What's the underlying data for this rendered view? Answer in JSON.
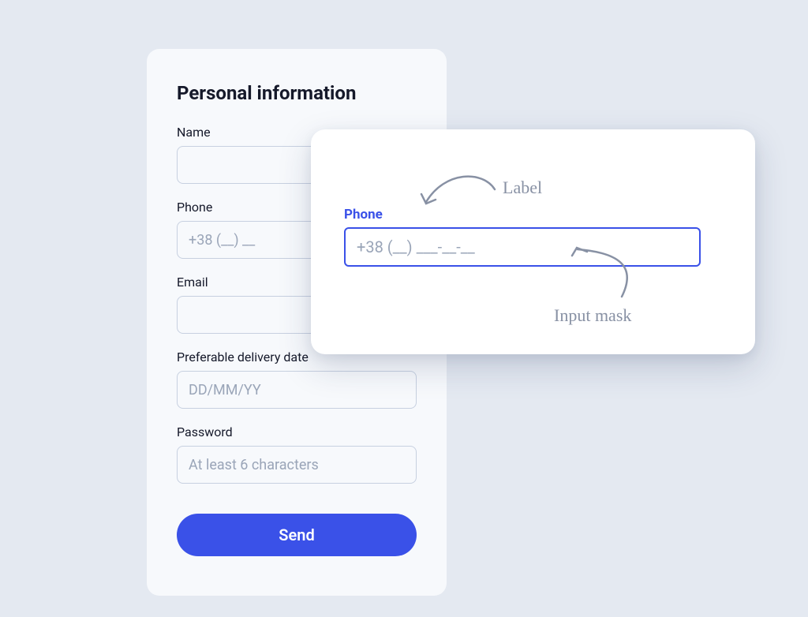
{
  "form": {
    "title": "Personal information",
    "name_label": "Name",
    "name_value": "",
    "phone_label": "Phone",
    "phone_placeholder": "+38 (__) __",
    "email_label": "Email",
    "email_value": "",
    "date_label": "Preferable delivery date",
    "date_placeholder": "DD/MM/YY",
    "password_label": "Password",
    "password_placeholder": "At least 6 characters",
    "send_label": "Send"
  },
  "callout": {
    "phone_label": "Phone",
    "phone_mask": "+38 (__) ___-__-__"
  },
  "annotations": {
    "label_text": "Label",
    "mask_text": "Input mask"
  }
}
